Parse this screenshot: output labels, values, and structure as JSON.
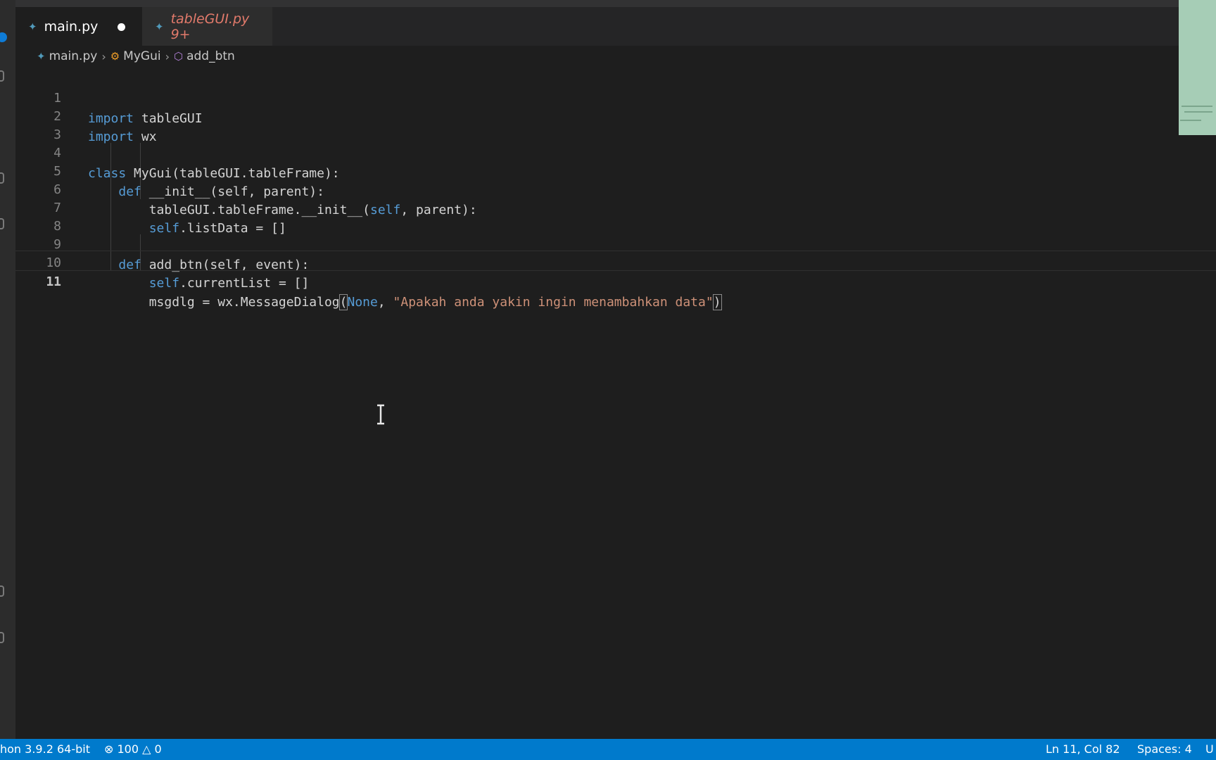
{
  "tabs": [
    {
      "label": "main.py",
      "state": "modified"
    },
    {
      "label": "tableGUI.py 9+",
      "state": "errors"
    }
  ],
  "breadcrumb": {
    "file": "main.py",
    "class": "MyGui",
    "method": "add_btn"
  },
  "editor": {
    "current_line": 11,
    "line_numbers": [
      "1",
      "2",
      "3",
      "4",
      "5",
      "6",
      "7",
      "8",
      "9",
      "10",
      "11"
    ],
    "code": {
      "l1_kw": "import",
      "l1_name": "tableGUI",
      "l2_kw": "import",
      "l2_name": "wx",
      "l4_kw": "class",
      "l4_rest": "MyGui(tableGUI.tableFrame):",
      "l5_kw": "def",
      "l5_rest": "__init__(self, parent):",
      "l6_a": "tableGUI.tableFrame.__init__(",
      "l6_self": "self",
      "l6_b": ", parent):",
      "l7_self": "self",
      "l7_rest": ".listData = []",
      "l9_kw": "def",
      "l9_rest": "add_btn(self, event):",
      "l10_self": "self",
      "l10_rest": ".currentList = []",
      "l11_a": "msgdlg = wx.MessageDialog",
      "l11_open": "(",
      "l11_none": "None",
      "l11_comma": ", ",
      "l11_str": "\"Apakah anda yakin ingin menambahkan data\"",
      "l11_close": ")"
    }
  },
  "statusbar": {
    "interpreter": "hon 3.9.2 64-bit",
    "errors": "100",
    "warnings": "0",
    "position": "Ln 11, Col 82",
    "spaces": "Spaces: 4",
    "encoding_partial": "U"
  },
  "colors": {
    "accent": "#007acc",
    "keyword": "#569cd6",
    "string": "#ce9178",
    "editor_bg": "#1e1e1e"
  },
  "icons": [
    "python-file-icon",
    "class-icon",
    "method-icon",
    "error-icon",
    "warning-icon",
    "text-cursor-icon"
  ]
}
